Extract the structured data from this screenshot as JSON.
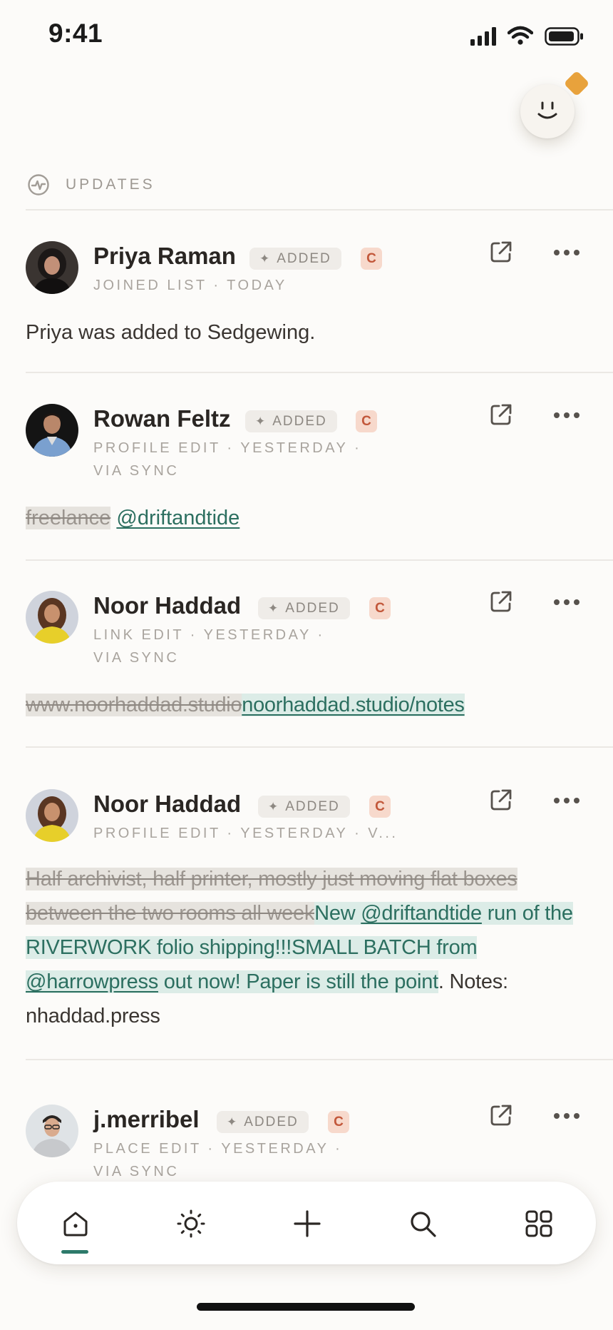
{
  "status": {
    "time": "9:41"
  },
  "section": {
    "title": "UPDATES"
  },
  "items": [
    {
      "name": "Priya Raman",
      "added_label": "ADDED",
      "badge": "C",
      "meta_line1": "JOINED LIST · TODAY",
      "meta_line2": "",
      "body": "Priya was added to Sedgewing."
    },
    {
      "name": "Rowan Feltz",
      "added_label": "ADDED",
      "badge": "C",
      "meta_line1": "PROFILE EDIT · YESTERDAY ·",
      "meta_line2": "VIA SYNC",
      "deleted": "freelance",
      "inserted": "@driftandtide"
    },
    {
      "name": "Noor Haddad",
      "added_label": "ADDED",
      "badge": "C",
      "meta_line1": "LINK EDIT · YESTERDAY ·",
      "meta_line2": "VIA SYNC",
      "deleted": "www.noorhaddad.studio",
      "inserted": "noorhaddad.studio/notes"
    },
    {
      "name": "Noor Haddad",
      "added_label": "ADDED",
      "badge": "C",
      "meta_line1": "PROFILE EDIT · YESTERDAY · V...",
      "deleted": "Half archivist, half printer, mostly just moving flat boxes between the two rooms all week",
      "ins_1": "New ",
      "ins_mention_1": "@driftandtide",
      "ins_2": " run of the RIVERWORK folio shipping!!!SMALL BATCH from ",
      "ins_mention_2": "@harrowpress",
      "ins_3": " out now! Paper is still the point",
      "plain": ". Notes: nhaddad.press"
    },
    {
      "name": "j.merribel",
      "added_label": "ADDED",
      "badge": "C",
      "meta_line1": "PLACE EDIT · YESTERDAY ·",
      "meta_line2": "VIA SYNC"
    }
  ],
  "icons": {
    "section": "activity-icon",
    "external": "external-link-icon",
    "more": "more-dots-icon"
  },
  "tabs": [
    "home-icon",
    "sun-icon",
    "plus-icon",
    "search-icon",
    "grid-icon"
  ],
  "colors": {
    "accent": "#2d7a6a",
    "badge_bg": "#f7d9cc",
    "badge_fg": "#c2573a",
    "mascot_badge": "#e8a23c"
  }
}
